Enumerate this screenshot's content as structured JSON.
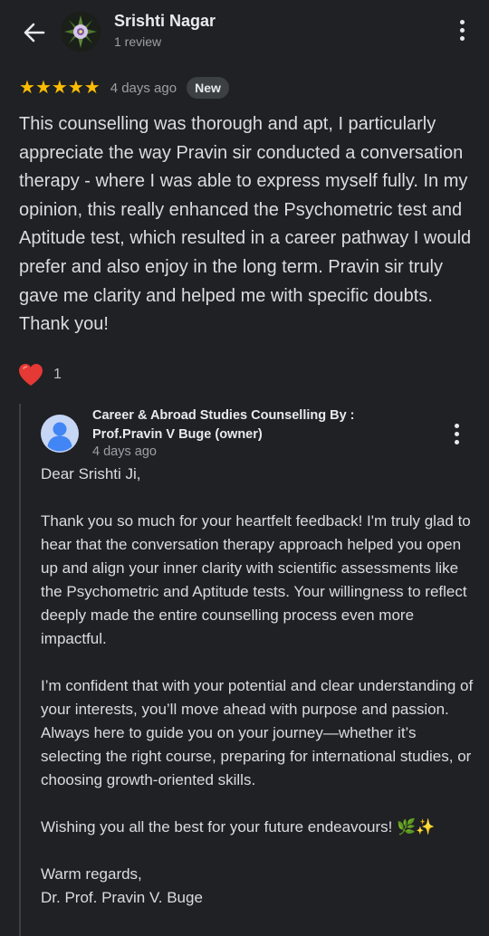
{
  "reviewer": {
    "name": "Srishti Nagar",
    "subtitle": "1 review"
  },
  "review": {
    "rating": 5,
    "stars": [
      "★",
      "★",
      "★",
      "★",
      "★"
    ],
    "date": "4 days ago",
    "badge": "New",
    "text": "This counselling was thorough and apt, I particularly appreciate the way Pravin sir conducted a conversation therapy - where I was able to express myself fully. In my opinion, this really enhanced the Psychometric test and Aptitude test, which resulted in a career pathway I would prefer and also enjoy in the long term. Pravin sir truly gave me clarity and helped me with specific doubts. Thank you!",
    "reaction_count": "1"
  },
  "owner_reply": {
    "name": "Career & Abroad Studies Counselling By : Prof.Pravin V Buge (owner)",
    "date": "4 days ago",
    "greeting": "Dear Srishti Ji,",
    "para1": "Thank you so much for your heartfelt feedback! I'm truly glad to hear that the conversation therapy approach helped you open up and align your inner clarity with scientific assessments like the Psychometric and Aptitude tests. Your willingness to reflect deeply made the entire counselling process even more impactful.",
    "para2": "I’m confident that with your potential and clear understanding of your interests, you’ll move ahead with purpose and passion. Always here to guide you on your journey—whether it’s selecting the right course, preparing for international studies, or choosing growth-oriented skills.",
    "para3": "Wishing you all the best for your future endeavours! 🌿✨",
    "closing": "Warm regards,",
    "signature": "Dr. Prof. Pravin V. Buge"
  },
  "colors": {
    "background": "#202124",
    "star": "#fbbc04",
    "heart": "#e53935",
    "owner_avatar": "#8ab4f8"
  }
}
